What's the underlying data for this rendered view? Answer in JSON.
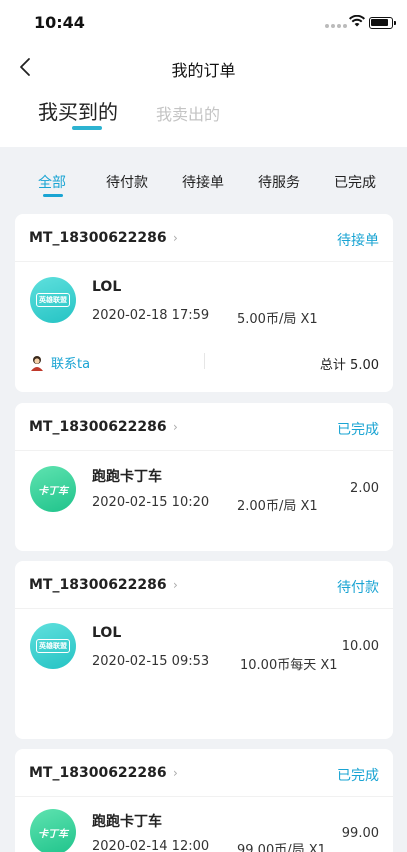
{
  "status_bar": {
    "time": "10:44"
  },
  "nav": {
    "title": "我的订单"
  },
  "segments": {
    "bought": "我买到的",
    "sold": "我卖出的"
  },
  "filters": [
    "全部",
    "待付款",
    "待接单",
    "待服务",
    "已完成"
  ],
  "orders": [
    {
      "id": "MT_18300622286",
      "status": "待接单",
      "game": "LOL",
      "logo_text": "英雄联盟",
      "date": "2020-02-18 17:59",
      "price": "5.00币/局 X1",
      "contact": "联系ta",
      "total": "总计 5.00"
    },
    {
      "id": "MT_18300622286",
      "status": "已完成",
      "game": "跑跑卡丁车",
      "logo_text": "卡丁车",
      "date": "2020-02-15 10:20",
      "price": "2.00币/局 X1",
      "amount": "2.00"
    },
    {
      "id": "MT_18300622286",
      "status": "待付款",
      "game": "LOL",
      "logo_text": "英雄联盟",
      "date": "2020-02-15 09:53",
      "price": "10.00币每天 X1",
      "amount": "10.00"
    },
    {
      "id": "MT_18300622286",
      "status": "已完成",
      "game": "跑跑卡丁车",
      "logo_text": "卡丁车",
      "date": "2020-02-14 12:00",
      "price": "99.00币/局 X1",
      "amount": "99.00"
    }
  ],
  "colors": {
    "accent": "#1aa4d3",
    "background": "#f0f2f5",
    "card": "#ffffff"
  },
  "icons": {
    "back": "chevron-left-icon",
    "chevron": "chevron-right-icon",
    "contact": "avatar-icon"
  }
}
